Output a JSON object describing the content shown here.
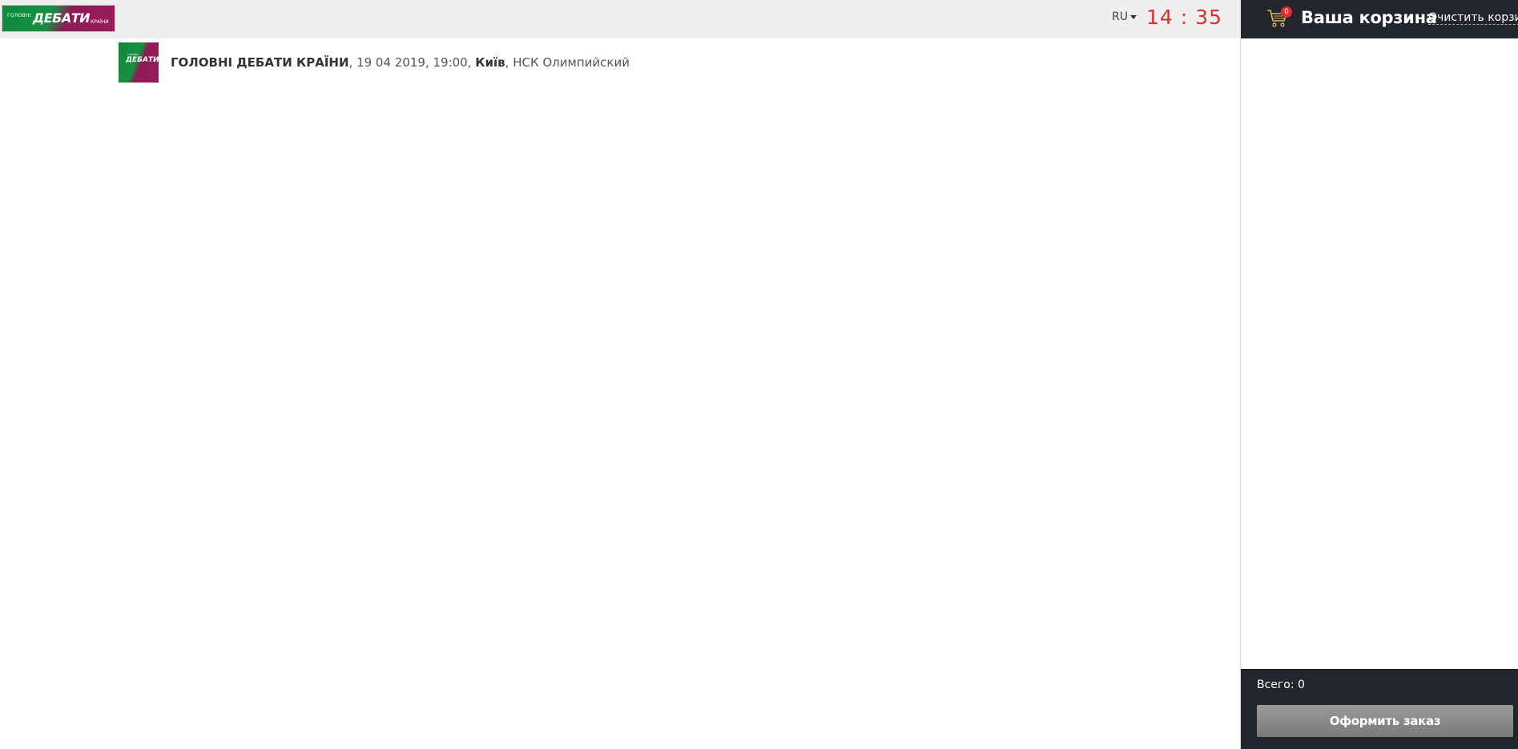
{
  "header": {
    "logo": {
      "small_text": "ГОЛОВНІ",
      "main_text": "ДЕБАТИ",
      "end_text": "КРАЇНИ"
    },
    "language": "RU",
    "timer": "14 : 35"
  },
  "event": {
    "name": "ГОЛОВНІ ДЕБАТИ КРАЇНИ",
    "date_time": ", 19 04 2019, 19:00, ",
    "city": "Київ",
    "venue": ", НСК Олимпийский"
  },
  "cart": {
    "title": "Ваша корзина",
    "count": "0",
    "clear_label": "Очистить корзину",
    "total_label": "Всего: 0",
    "checkout_label": "Оформить заказ"
  },
  "colors": {
    "accent_red": "#e32b2b",
    "cart_dark": "#22252b",
    "brand_green": "#179040",
    "brand_magenta": "#9c1a5a"
  }
}
